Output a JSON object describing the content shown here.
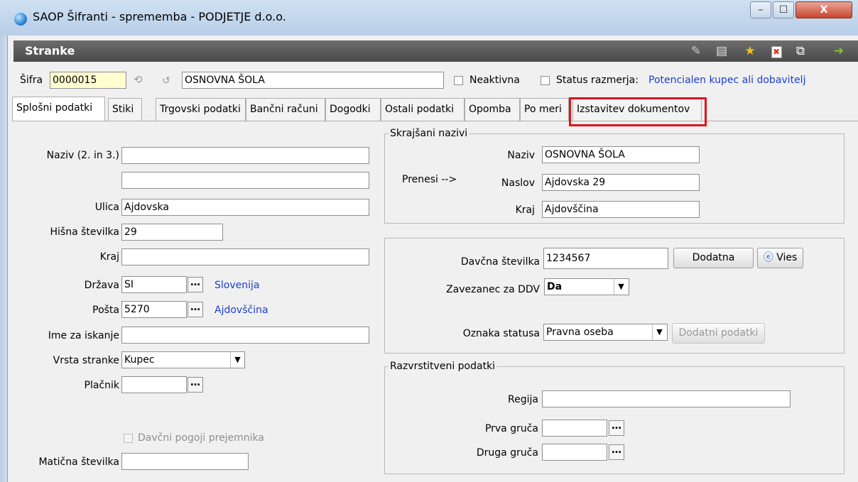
{
  "window": {
    "title": "SAOP Šifranti - sprememba - PODJETJE d.o.o.",
    "minimize": "–",
    "maximize": "☐",
    "close": "X"
  },
  "header": {
    "title": "Stranke",
    "icons": [
      "edit-icon",
      "table-icon",
      "star-icon",
      "delete-icon",
      "copy-icon",
      "exit-icon"
    ]
  },
  "top": {
    "sifra_label": "Šifra",
    "sifra_value": "0000015",
    "name_value": "OSNOVNA ŠOLA",
    "neaktivna_label": "Neaktivna",
    "status_label": "Status razmerja:",
    "status_value": "Potencialen kupec ali dobavitelj"
  },
  "tabs": [
    {
      "label": "Splošni podatki"
    },
    {
      "label": "Stiki"
    },
    {
      "label": "Trgovski podatki"
    },
    {
      "label": "Bančni računi"
    },
    {
      "label": "Dogodki"
    },
    {
      "label": "Ostali podatki"
    },
    {
      "label": "Opomba"
    },
    {
      "label": "Po meri"
    },
    {
      "label": "Izstavitev dokumentov"
    }
  ],
  "left": {
    "naziv_label": "Naziv (2. in 3.)",
    "naziv1": "",
    "naziv2": "",
    "ulica_label": "Ulica",
    "ulica_value": "Ajdovska",
    "hisna_label": "Hišna številka",
    "hisna_value": "29",
    "kraj_label": "Kraj",
    "kraj_value": "",
    "drzava_label": "Država",
    "drzava_value": "SI",
    "drzava_name": "Slovenija",
    "posta_label": "Pošta",
    "posta_value": "5270",
    "posta_name": "Ajdovščina",
    "ime_label": "Ime za iskanje",
    "ime_value": "",
    "vrsta_label": "Vrsta stranke",
    "vrsta_value": "Kupec",
    "placnik_label": "Plačnik",
    "placnik_value": "",
    "davcni_pogoji_label": "Davčni pogoji prejemnika",
    "maticna_label": "Matična številka",
    "maticna_value": ""
  },
  "skrajsani": {
    "title": "Skrajšani nazivi",
    "prenesi_label": "Prenesi -->",
    "naziv_label": "Naziv",
    "naziv_value": "OSNOVNA ŠOLA",
    "naslov_label": "Naslov",
    "naslov_value": "Ajdovska 29",
    "kraj_label": "Kraj",
    "kraj_value": "Ajdovščina"
  },
  "davcni": {
    "davcna_label": "Davčna številka",
    "davcna_value": "1234567",
    "dodatna_label": "Dodatna",
    "vies_label": "Vies",
    "zavezanec_label": "Zavezanec za DDV",
    "zavezanec_value": "Da",
    "oznaka_label": "Oznaka statusa",
    "oznaka_value": "Pravna oseba",
    "dodatni_podatki_label": "Dodatni podatki"
  },
  "razvrstitveni": {
    "title": "Razvrstitveni podatki",
    "regija_label": "Regija",
    "regija_value": "",
    "prva_label": "Prva gruča",
    "prva_value": "",
    "druga_label": "Druga gruča",
    "druga_value": ""
  }
}
